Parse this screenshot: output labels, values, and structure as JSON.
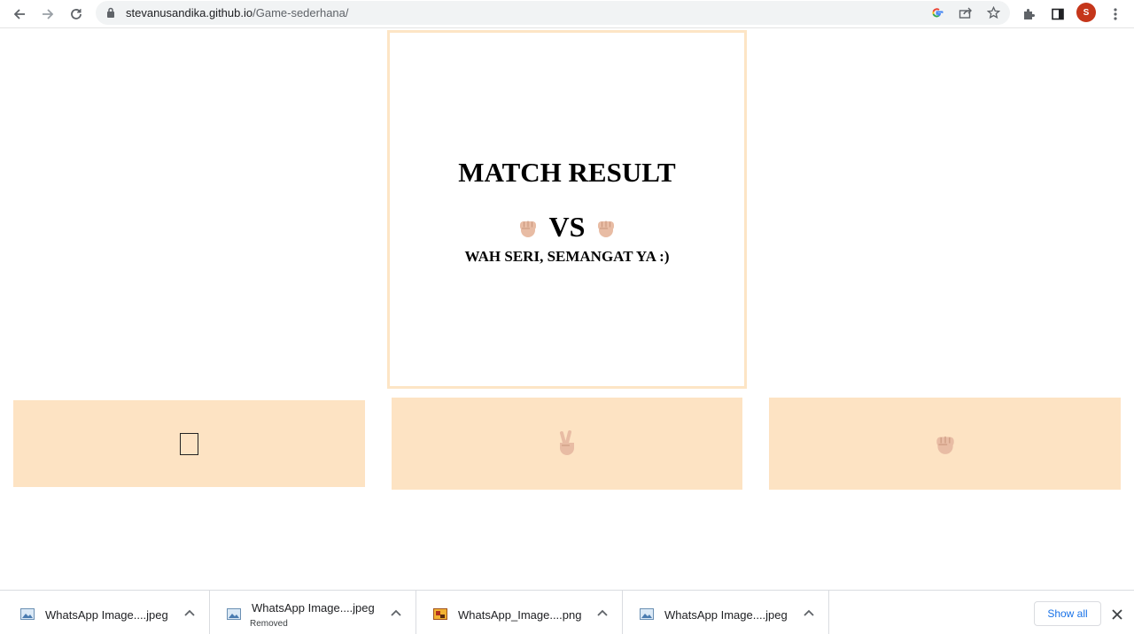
{
  "browser": {
    "url_host": "stevanusandika.github.io",
    "url_path": "/Game-sederhana/",
    "profile_initial": "S",
    "profile_color": "#c5361a"
  },
  "game": {
    "title": "MATCH RESULT",
    "vs_label": "VS",
    "player_hand": "fist-icon",
    "computer_hand": "fist-icon",
    "message": "WAH SERI, SEMANGAT YA :)",
    "choices": [
      {
        "icon": "missing-glyph"
      },
      {
        "icon": "peace-hand-icon"
      },
      {
        "icon": "fist-icon"
      }
    ],
    "accent_color": "#fde3c3"
  },
  "downloads": {
    "items": [
      {
        "name": "WhatsApp Image....jpeg",
        "status": "",
        "icon": "image-file-icon"
      },
      {
        "name": "WhatsApp Image....jpeg",
        "status": "Removed",
        "icon": "image-file-icon"
      },
      {
        "name": "WhatsApp_Image....png",
        "status": "",
        "icon": "png-file-icon"
      },
      {
        "name": "WhatsApp Image....jpeg",
        "status": "",
        "icon": "image-file-icon"
      }
    ],
    "show_all_label": "Show all"
  }
}
